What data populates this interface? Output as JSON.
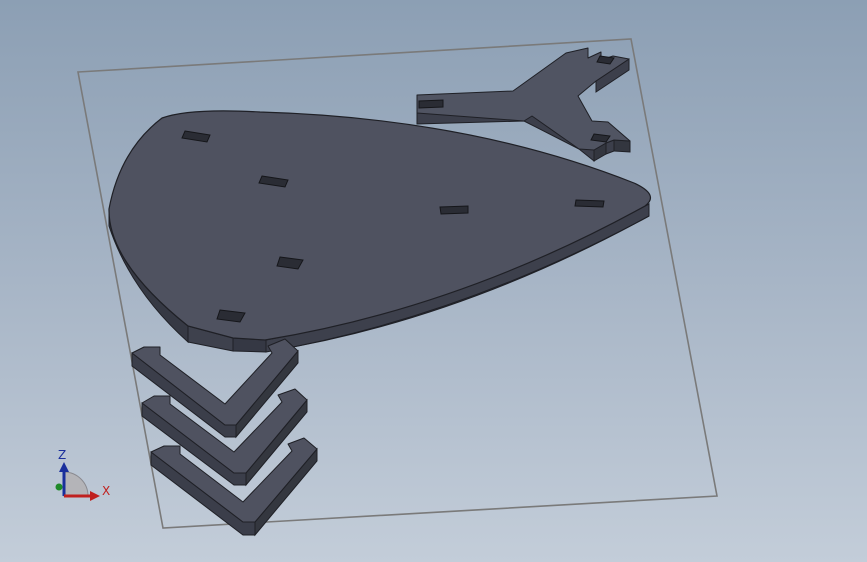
{
  "viewport": {
    "background_top": "#8c9fb4",
    "background_bottom": "#c3cdd9"
  },
  "model": {
    "face_color": "#4e5160",
    "side_color": "#3c3f4b",
    "edge_color": "#1f2026",
    "plane_color": "#7a7a7a",
    "parts": [
      "sketch-plane",
      "teardrop-base-plate",
      "y-shaped-bracket",
      "chevron-bracket-1",
      "chevron-bracket-2",
      "chevron-bracket-3"
    ]
  },
  "triad": {
    "z_label": "Z",
    "x_label": "X",
    "x_color": "#c0201e",
    "z_color": "#1a2f9c",
    "y_color": "#1f8a2a"
  }
}
